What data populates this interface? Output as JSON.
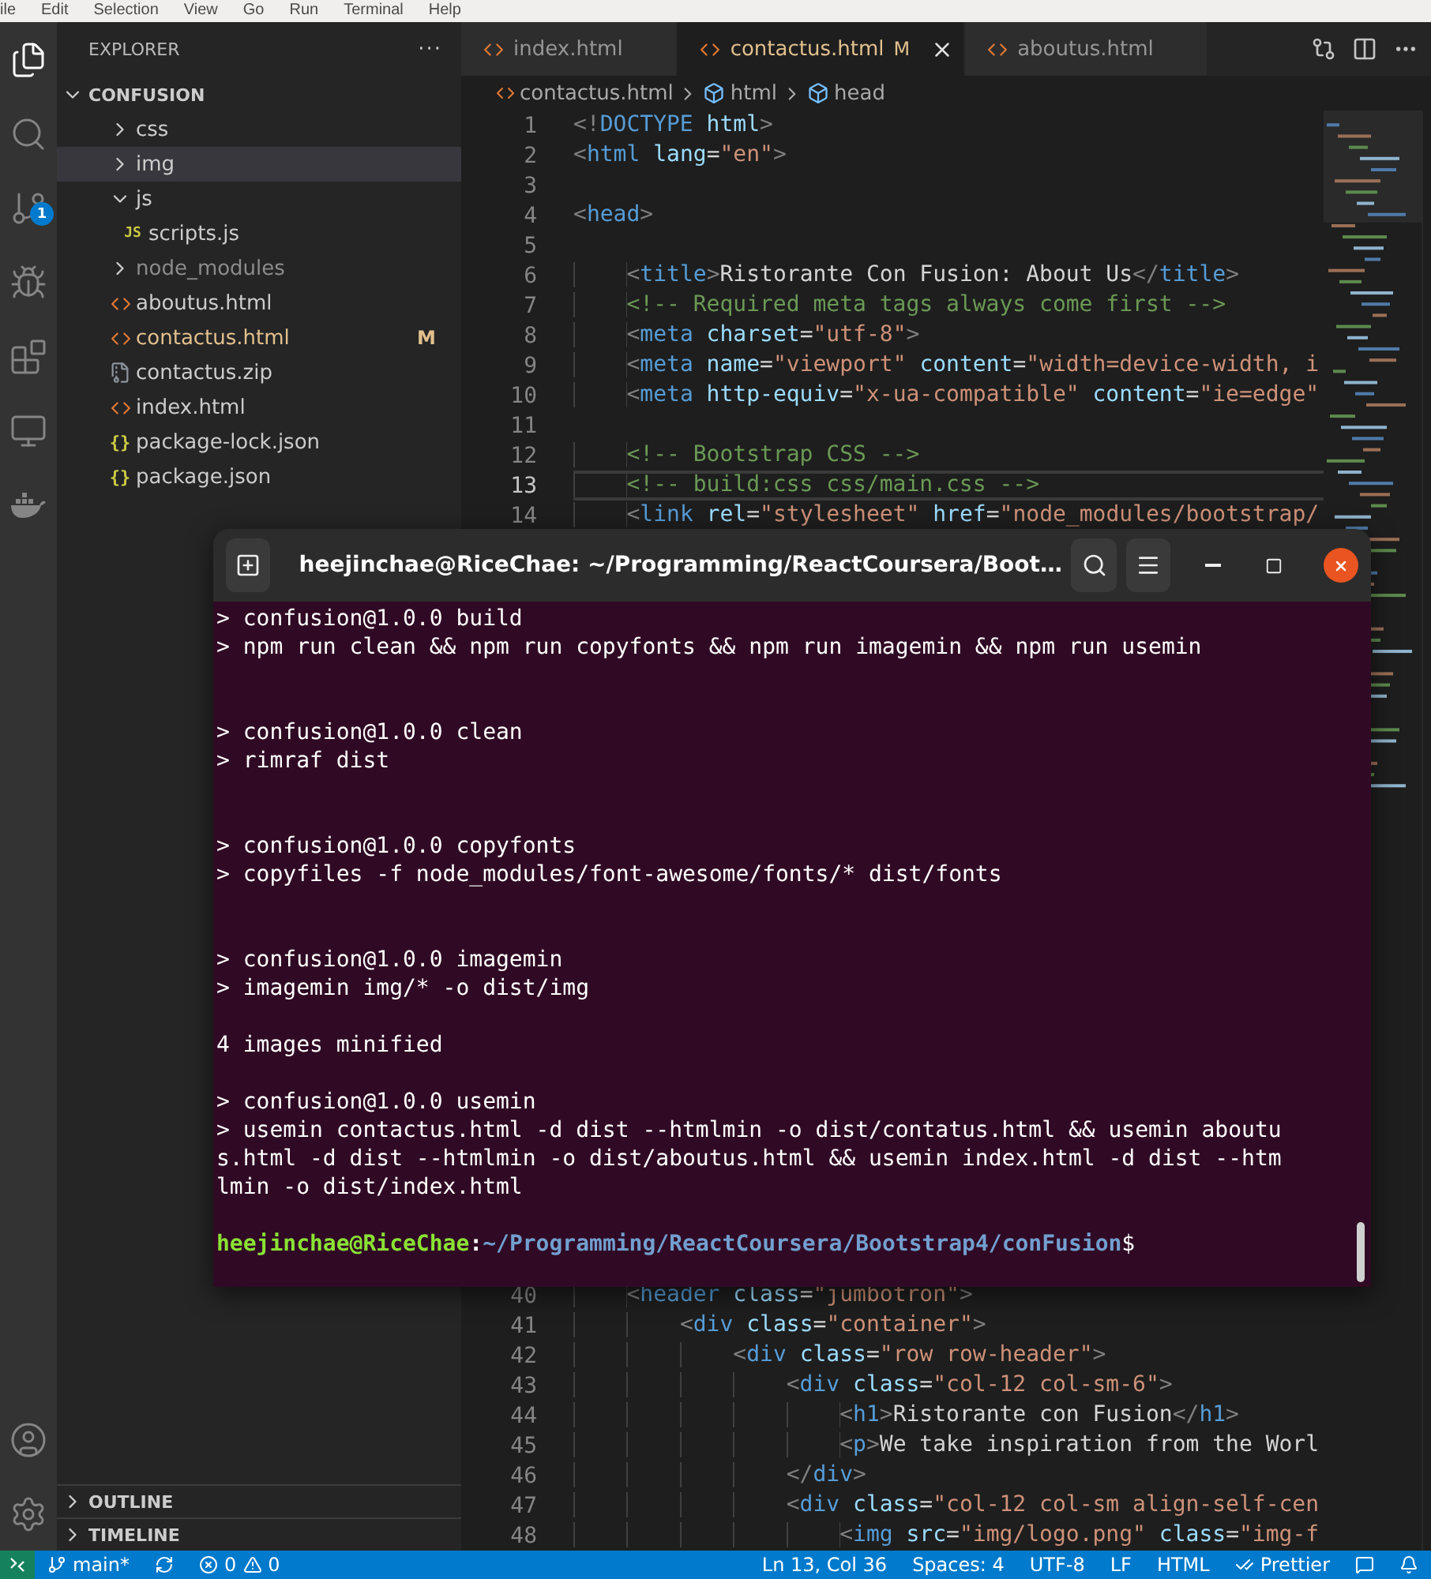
{
  "menu_bar": [
    "ile",
    "Edit",
    "Selection",
    "View",
    "Go",
    "Run",
    "Terminal",
    "Help"
  ],
  "activity_bar": {
    "items": [
      {
        "kind": "explorer",
        "selected": true
      },
      {
        "kind": "search",
        "selected": false
      },
      {
        "kind": "source_control",
        "selected": false,
        "badge": "1"
      },
      {
        "kind": "debug",
        "selected": false
      },
      {
        "kind": "extensions",
        "selected": false
      },
      {
        "kind": "remote",
        "selected": false
      },
      {
        "kind": "docker",
        "selected": false
      }
    ],
    "bottom": [
      {
        "kind": "account"
      },
      {
        "kind": "settings"
      }
    ]
  },
  "sidebar": {
    "title": "EXPLORER",
    "more": "···",
    "root": {
      "label": "CONFUSION",
      "expanded": true,
      "children": [
        {
          "label": "css",
          "kind": "folder",
          "expanded": false,
          "selected": false,
          "ignored": false
        },
        {
          "label": "img",
          "kind": "folder",
          "expanded": false,
          "selected": true,
          "ignored": false
        },
        {
          "label": "js",
          "kind": "folder",
          "expanded": true,
          "selected": false,
          "ignored": false,
          "children": [
            {
              "label": "scripts.js",
              "kind": "js",
              "icon_label": "JS",
              "selected": false,
              "ignored": false
            }
          ]
        },
        {
          "label": "node_modules",
          "kind": "folder",
          "expanded": false,
          "selected": false,
          "ignored": true
        },
        {
          "label": "aboutus.html",
          "kind": "html",
          "selected": false,
          "ignored": false
        },
        {
          "label": "contactus.html",
          "kind": "html",
          "selected": false,
          "ignored": false,
          "status": "M"
        },
        {
          "label": "contactus.zip",
          "kind": "zip",
          "selected": false,
          "ignored": false
        },
        {
          "label": "index.html",
          "kind": "html",
          "selected": false,
          "ignored": false
        },
        {
          "label": "package-lock.json",
          "kind": "json",
          "icon_label": "{}",
          "selected": false,
          "ignored": false
        },
        {
          "label": "package.json",
          "kind": "json",
          "icon_label": "{}",
          "selected": false,
          "ignored": false
        }
      ]
    },
    "sections": [
      {
        "label": "OUTLINE",
        "expanded": false
      },
      {
        "label": "TIMELINE",
        "expanded": false
      }
    ]
  },
  "tabs": [
    {
      "label": "index.html",
      "selected": false
    },
    {
      "label": "contactus.html",
      "selected": true,
      "status": "M"
    },
    {
      "label": "aboutus.html",
      "selected": false
    }
  ],
  "breadcrumb": {
    "file": "contactus.html",
    "symbols": [
      "html",
      "head"
    ]
  },
  "code_top": [
    {
      "n": "1",
      "current": false,
      "tokens": [
        {
          "kind": "punct",
          "text": "<!"
        },
        {
          "kind": "tag",
          "text": "DOCTYPE"
        },
        {
          "kind": "attr",
          "text": " html"
        },
        {
          "kind": "punct",
          "text": ">"
        }
      ]
    },
    {
      "n": "2",
      "current": false,
      "tokens": [
        {
          "kind": "punct",
          "text": "<"
        },
        {
          "kind": "tag",
          "text": "html"
        },
        {
          "kind": "attr",
          "text": " lang"
        },
        {
          "kind": "text",
          "text": "="
        },
        {
          "kind": "string",
          "text": "\"en\""
        },
        {
          "kind": "punct",
          "text": ">"
        }
      ]
    },
    {
      "n": "3",
      "current": false
    },
    {
      "n": "4",
      "current": false,
      "tokens": [
        {
          "kind": "punct",
          "text": "<"
        },
        {
          "kind": "tag",
          "text": "head"
        },
        {
          "kind": "punct",
          "text": ">"
        }
      ]
    },
    {
      "n": "5",
      "current": false
    },
    {
      "n": "6",
      "current": false,
      "tokens": [
        {
          "kind": "punct",
          "text": "    <"
        },
        {
          "kind": "tag",
          "text": "title"
        },
        {
          "kind": "punct",
          "text": ">"
        },
        {
          "kind": "text",
          "text": "Ristorante Con Fusion: About Us"
        },
        {
          "kind": "punct",
          "text": "</"
        },
        {
          "kind": "tag",
          "text": "title"
        },
        {
          "kind": "punct",
          "text": ">"
        }
      ]
    },
    {
      "n": "7",
      "current": false,
      "tokens": [
        {
          "kind": "comment",
          "text": "    <!-- Required meta tags always come first -->"
        }
      ]
    },
    {
      "n": "8",
      "current": false,
      "tokens": [
        {
          "kind": "punct",
          "text": "    <"
        },
        {
          "kind": "tag",
          "text": "meta"
        },
        {
          "kind": "attr",
          "text": " charset"
        },
        {
          "kind": "text",
          "text": "="
        },
        {
          "kind": "string",
          "text": "\"utf-8\""
        },
        {
          "kind": "punct",
          "text": ">"
        }
      ]
    },
    {
      "n": "9",
      "current": false,
      "tokens": [
        {
          "kind": "punct",
          "text": "    <"
        },
        {
          "kind": "tag",
          "text": "meta"
        },
        {
          "kind": "attr",
          "text": " name"
        },
        {
          "kind": "text",
          "text": "="
        },
        {
          "kind": "string",
          "text": "\"viewport\""
        },
        {
          "kind": "attr",
          "text": " content"
        },
        {
          "kind": "text",
          "text": "="
        },
        {
          "kind": "string",
          "text": "\"width=device-width, i"
        }
      ]
    },
    {
      "n": "10",
      "current": false,
      "tokens": [
        {
          "kind": "punct",
          "text": "    <"
        },
        {
          "kind": "tag",
          "text": "meta"
        },
        {
          "kind": "attr",
          "text": " http-equiv"
        },
        {
          "kind": "text",
          "text": "="
        },
        {
          "kind": "string",
          "text": "\"x-ua-compatible\""
        },
        {
          "kind": "attr",
          "text": " content"
        },
        {
          "kind": "text",
          "text": "="
        },
        {
          "kind": "string",
          "text": "\"ie=edge\""
        }
      ]
    },
    {
      "n": "11",
      "current": false
    },
    {
      "n": "12",
      "current": false,
      "tokens": [
        {
          "kind": "comment",
          "text": "    <!-- Bootstrap CSS -->"
        }
      ]
    },
    {
      "n": "13",
      "current": true,
      "tokens": [
        {
          "kind": "comment",
          "text": "    <!-- build:css css/main.css -->"
        }
      ]
    },
    {
      "n": "14",
      "current": false,
      "tokens": [
        {
          "kind": "punct",
          "text": "    <"
        },
        {
          "kind": "tag",
          "text": "link"
        },
        {
          "kind": "attr",
          "text": " rel"
        },
        {
          "kind": "text",
          "text": "="
        },
        {
          "kind": "string",
          "text": "\"stylesheet\""
        },
        {
          "kind": "attr",
          "text": " href"
        },
        {
          "kind": "text",
          "text": "="
        },
        {
          "kind": "string",
          "text": "\"node_modules/bootstrap/"
        }
      ]
    }
  ],
  "code_bottom": [
    {
      "n": "40",
      "current": false,
      "tokens": [
        {
          "kind": "punct",
          "text": "    <"
        },
        {
          "kind": "tag",
          "text": "header"
        },
        {
          "kind": "attr",
          "text": " class"
        },
        {
          "kind": "text",
          "text": "="
        },
        {
          "kind": "string",
          "text": "\"jumbotron\""
        },
        {
          "kind": "punct",
          "text": ">"
        }
      ]
    },
    {
      "n": "41",
      "current": false,
      "tokens": [
        {
          "kind": "punct",
          "text": "        <"
        },
        {
          "kind": "tag",
          "text": "div"
        },
        {
          "kind": "attr",
          "text": " class"
        },
        {
          "kind": "text",
          "text": "="
        },
        {
          "kind": "string",
          "text": "\"container\""
        },
        {
          "kind": "punct",
          "text": ">"
        }
      ]
    },
    {
      "n": "42",
      "current": false,
      "tokens": [
        {
          "kind": "punct",
          "text": "            <"
        },
        {
          "kind": "tag",
          "text": "div"
        },
        {
          "kind": "attr",
          "text": " class"
        },
        {
          "kind": "text",
          "text": "="
        },
        {
          "kind": "string",
          "text": "\"row row-header\""
        },
        {
          "kind": "punct",
          "text": ">"
        }
      ]
    },
    {
      "n": "43",
      "current": false,
      "tokens": [
        {
          "kind": "punct",
          "text": "                <"
        },
        {
          "kind": "tag",
          "text": "div"
        },
        {
          "kind": "attr",
          "text": " class"
        },
        {
          "kind": "text",
          "text": "="
        },
        {
          "kind": "string",
          "text": "\"col-12 col-sm-6\""
        },
        {
          "kind": "punct",
          "text": ">"
        }
      ]
    },
    {
      "n": "44",
      "current": false,
      "tokens": [
        {
          "kind": "punct",
          "text": "                    <"
        },
        {
          "kind": "tag",
          "text": "h1"
        },
        {
          "kind": "punct",
          "text": ">"
        },
        {
          "kind": "text",
          "text": "Ristorante con Fusion"
        },
        {
          "kind": "punct",
          "text": "</"
        },
        {
          "kind": "tag",
          "text": "h1"
        },
        {
          "kind": "punct",
          "text": ">"
        }
      ]
    },
    {
      "n": "45",
      "current": false,
      "tokens": [
        {
          "kind": "punct",
          "text": "                    <"
        },
        {
          "kind": "tag",
          "text": "p"
        },
        {
          "kind": "punct",
          "text": ">"
        },
        {
          "kind": "text",
          "text": "We take inspiration from the Worl"
        }
      ]
    },
    {
      "n": "46",
      "current": false,
      "tokens": [
        {
          "kind": "punct",
          "text": "                </"
        },
        {
          "kind": "tag",
          "text": "div"
        },
        {
          "kind": "punct",
          "text": ">"
        }
      ]
    },
    {
      "n": "47",
      "current": false,
      "tokens": [
        {
          "kind": "punct",
          "text": "                <"
        },
        {
          "kind": "tag",
          "text": "div"
        },
        {
          "kind": "attr",
          "text": " class"
        },
        {
          "kind": "text",
          "text": "="
        },
        {
          "kind": "string",
          "text": "\"col-12 col-sm align-self-cen"
        }
      ]
    },
    {
      "n": "48",
      "current": false,
      "tokens": [
        {
          "kind": "punct",
          "text": "                    <"
        },
        {
          "kind": "tag",
          "text": "img"
        },
        {
          "kind": "attr",
          "text": " src"
        },
        {
          "kind": "text",
          "text": "="
        },
        {
          "kind": "string",
          "text": "\"img/logo.png\""
        },
        {
          "kind": "attr",
          "text": " class"
        },
        {
          "kind": "text",
          "text": "="
        },
        {
          "kind": "string",
          "text": "\"img-f"
        }
      ]
    }
  ],
  "terminal": {
    "title": "heejinchae@RiceChae: ~/Programming/ReactCoursera/Boot…",
    "output": [
      {
        "kind": "script",
        "lines": [
          "> confusion@1.0.0 build",
          "> npm run clean && npm run copyfonts && npm run imagemin && npm run usemin"
        ]
      },
      {
        "kind": "script",
        "lines": [
          "> confusion@1.0.0 clean",
          "> rimraf dist"
        ]
      },
      {
        "kind": "script",
        "lines": [
          "> confusion@1.0.0 copyfonts",
          "> copyfiles -f node_modules/font-awesome/fonts/* dist/fonts"
        ]
      },
      {
        "kind": "script",
        "lines": [
          "> confusion@1.0.0 imagemin",
          "> imagemin img/* -o dist/img"
        ]
      },
      {
        "kind": "message",
        "lines": [
          "4 images minified"
        ]
      },
      {
        "kind": "script",
        "lines": [
          "> confusion@1.0.0 usemin",
          "> usemin contactus.html -d dist --htmlmin -o dist/contatus.html && usemin aboutu",
          "s.html -d dist --htmlmin -o dist/aboutus.html && usemin index.html -d dist --htm",
          "lmin -o dist/index.html"
        ]
      }
    ],
    "prompt": {
      "user": "heejinchae@RiceChae",
      "separator": ":",
      "path": "~/Programming/ReactCoursera/Bootstrap4/conFusion",
      "symbol": "$"
    }
  },
  "status_bar": {
    "branch": "main*",
    "errors": "0",
    "warnings": "0",
    "right": [
      "Ln 13, Col 36",
      "Spaces: 4",
      "UTF-8",
      "LF",
      "HTML"
    ],
    "formatter": "Prettier"
  }
}
